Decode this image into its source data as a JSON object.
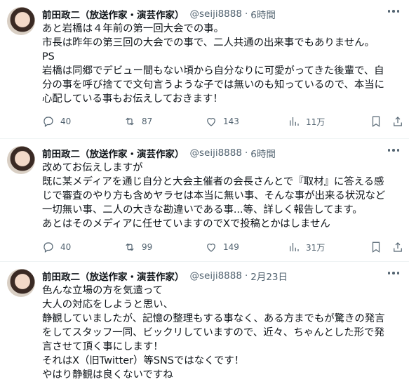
{
  "tweets": [
    {
      "name": "前田政二（放送作家・演芸作家）",
      "handle": "@seiji8888",
      "time": "6時間",
      "lines": [
        "あと岩橋は４年前の第一回大会での事。",
        "市長は昨年の第三回の大会での事で、二人共通の出来事でもありません。",
        "PS",
        "岩橋は同郷でデビュー間もない頃から自分なりに可愛がってきた後輩で、自",
        "分の事を呼び捨てで文句言うような子では無いのも知っているので、本当に",
        "心配している事もお伝えしておきます！"
      ],
      "replies": "40",
      "retweets": "87",
      "likes": "143",
      "views": "11万"
    },
    {
      "name": "前田政二（放送作家・演芸作家）",
      "handle": "@seiji8888",
      "time": "6時間",
      "lines": [
        "改めてお伝えしますが",
        "既に某メディアを通じ自分と大会主催者の会長さんとで『取材』に答える感",
        "じで審査のやり方も含めヤラセは本当に無い事、そんな事が出来る状況など",
        "一切無い事、二人の大きな勘違いである事...等、詳しく報告してます。",
        "あとはそのメディアに任せていますのでXで投稿とかはしません"
      ],
      "replies": "40",
      "retweets": "99",
      "likes": "149",
      "views": "31万"
    },
    {
      "name": "前田政二（放送作家・演芸作家）",
      "handle": "@seiji8888",
      "time": "2月23日",
      "lines": [
        "色んな立場の方を気遣って",
        "大人の対応をしようと思い、",
        "静観していましたが、記憶の整理もする事なく、ある方までもが驚きの発言",
        "をしてスタッフ一同、ビックリしていますので、近々、ちゃんとした形で発",
        "言させて頂く事にします！",
        "それはX（旧Twitter）等SNSではなくです！",
        "やはり静観は良くないですね"
      ]
    }
  ],
  "separator": "·"
}
